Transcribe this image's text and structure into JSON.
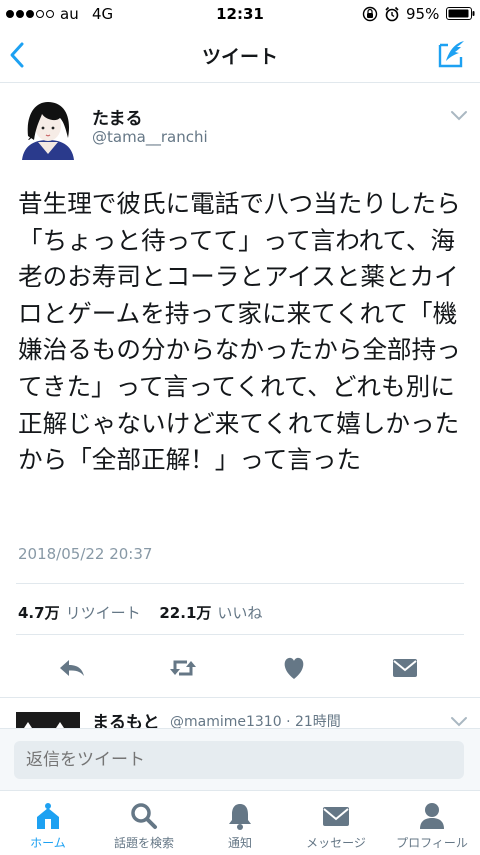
{
  "status_bar": {
    "carrier": "au",
    "network": "4G",
    "time": "12:31",
    "battery": "95%",
    "signal_strength": 3
  },
  "nav": {
    "title": "ツイート"
  },
  "tweet": {
    "author": {
      "name": "たまる",
      "handle": "@tama__ranchi"
    },
    "text": "昔生理で彼氏に電話で八つ当たりしたら「ちょっと待ってて」って言われて、海老のお寿司とコーラとアイスと薬とカイロとゲームを持って家に来てくれて「機嫌治るもの分からなかったから全部持ってきた」って言ってくれて、どれも別に正解じゃないけど来てくれて嬉しかったから「全部正解！」って言った",
    "timestamp": "2018/05/22 20:37",
    "retweets": {
      "count": "4.7万",
      "label": "リツイート"
    },
    "likes": {
      "count": "22.1万",
      "label": "いいね"
    }
  },
  "next_reply": {
    "name": "まるもと",
    "meta": "@mamime1310 · 21時間"
  },
  "composer": {
    "placeholder": "返信をツイート"
  },
  "tab_bar": {
    "tabs": [
      {
        "label": "ホーム",
        "icon": "home-icon",
        "active": true
      },
      {
        "label": "話題を検索",
        "icon": "search-icon",
        "active": false
      },
      {
        "label": "通知",
        "icon": "bell-icon",
        "active": false
      },
      {
        "label": "メッセージ",
        "icon": "envelope-icon",
        "active": false
      },
      {
        "label": "プロフィール",
        "icon": "person-icon",
        "active": false
      }
    ]
  },
  "colors": {
    "accent": "#1da1f2",
    "text": "#14171a",
    "secondary": "#657786",
    "icon_gray": "#657786"
  }
}
